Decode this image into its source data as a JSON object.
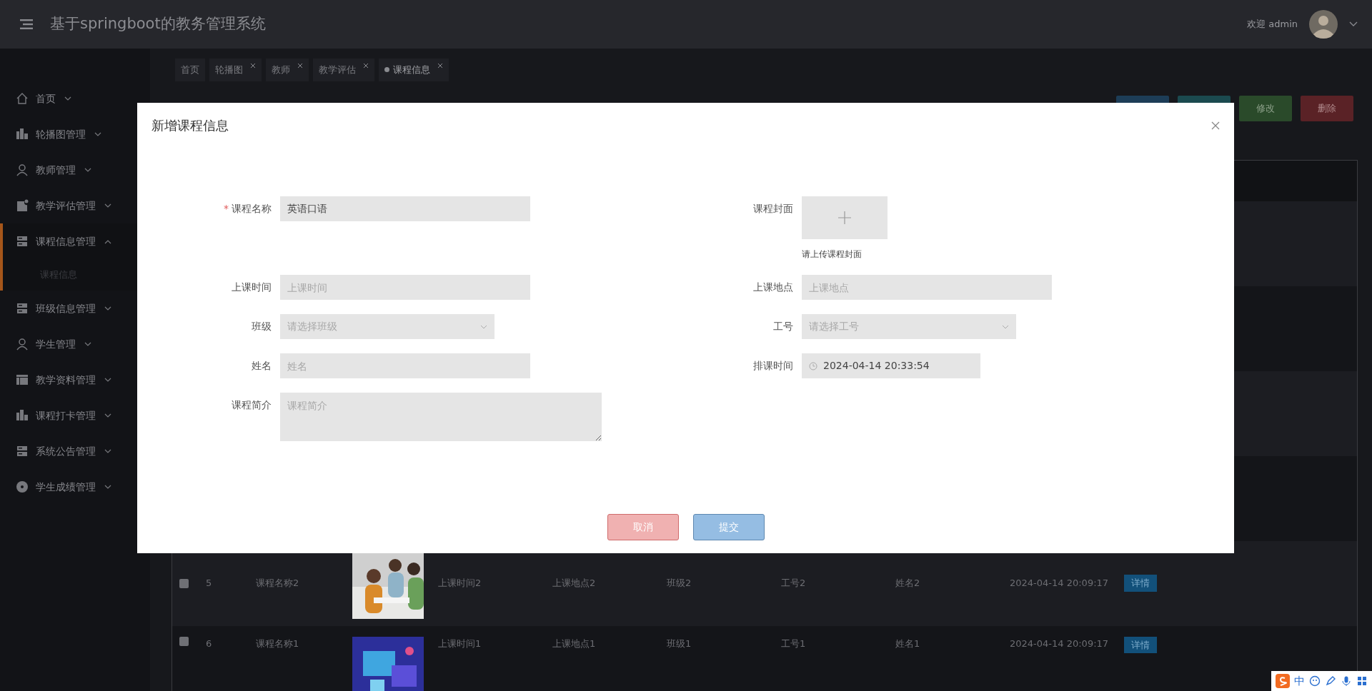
{
  "header": {
    "title": "基于springboot的教务管理系统",
    "welcome": "欢迎 admin"
  },
  "sidebar": {
    "items": [
      {
        "label": "首页",
        "kind": "home",
        "expanded": false
      },
      {
        "label": "轮播图管理",
        "kind": "building",
        "expanded": false
      },
      {
        "label": "教师管理",
        "kind": "person",
        "expanded": false
      },
      {
        "label": "教学评估管理",
        "kind": "note",
        "expanded": false
      },
      {
        "label": "课程信息管理",
        "kind": "stack",
        "expanded": true,
        "children": [
          {
            "label": "课程信息"
          }
        ]
      },
      {
        "label": "班级信息管理",
        "kind": "stack",
        "expanded": false
      },
      {
        "label": "学生管理",
        "kind": "person",
        "expanded": false
      },
      {
        "label": "教学资料管理",
        "kind": "table",
        "expanded": false
      },
      {
        "label": "课程打卡管理",
        "kind": "building",
        "expanded": false
      },
      {
        "label": "系统公告管理",
        "kind": "stack",
        "expanded": false
      },
      {
        "label": "学生成绩管理",
        "kind": "disc",
        "expanded": false
      }
    ]
  },
  "tabs": [
    {
      "label": "首页",
      "closable": false,
      "selected": false
    },
    {
      "label": "轮播图",
      "closable": true,
      "selected": false
    },
    {
      "label": "教师",
      "closable": true,
      "selected": false
    },
    {
      "label": "教学评估",
      "closable": true,
      "selected": false
    },
    {
      "label": "课程信息",
      "closable": true,
      "selected": true
    }
  ],
  "toolbar": [
    {
      "kind": "primary"
    },
    {
      "kind": "info"
    },
    {
      "label": "修改",
      "kind": "edit"
    },
    {
      "label": "删除",
      "kind": "delete"
    }
  ],
  "table": {
    "rows": [
      {
        "checked": false,
        "no": "5",
        "name": "课程名称2",
        "time": "上课时间2",
        "place": "上课地点2",
        "class": "班级2",
        "staff_no": "工号2",
        "teacher": "姓名2",
        "scheduled": "2024-04-14 20:09:17",
        "action": "详情"
      },
      {
        "checked": false,
        "no": "6",
        "name": "课程名称1",
        "time": "上课时间1",
        "place": "上课地点1",
        "class": "班级1",
        "staff_no": "工号1",
        "teacher": "姓名1",
        "scheduled": "2024-04-14 20:09:17",
        "action": "详情"
      }
    ]
  },
  "dialog": {
    "title": "新增课程信息",
    "rows": [
      {
        "left": {
          "label": "课程名称",
          "required_mark": "*",
          "kind": "text",
          "value": "英语口语"
        },
        "right": {
          "label": "课程封面",
          "kind": "upload",
          "hint": "请上传课程封面"
        }
      },
      {
        "left": {
          "label": "上课时间",
          "kind": "text",
          "placeholder": "上课时间"
        },
        "right": {
          "label": "上课地点",
          "kind": "text",
          "placeholder": "上课地点"
        }
      },
      {
        "left": {
          "label": "班级",
          "kind": "select",
          "placeholder": "请选择班级"
        },
        "right": {
          "label": "工号",
          "kind": "select",
          "placeholder": "请选择工号"
        }
      },
      {
        "left": {
          "label": "姓名",
          "kind": "text",
          "placeholder": "姓名"
        },
        "right": {
          "label": "排课时间",
          "kind": "datetime",
          "value": "2024-04-14 20:33:54"
        }
      },
      {
        "left": {
          "label": "课程简介",
          "kind": "textarea",
          "placeholder": "课程简介"
        }
      }
    ],
    "buttons": [
      {
        "label": "取消",
        "kind": "cancel"
      },
      {
        "label": "提交",
        "kind": "submit"
      }
    ]
  },
  "ime_bar": {
    "label": "中"
  }
}
